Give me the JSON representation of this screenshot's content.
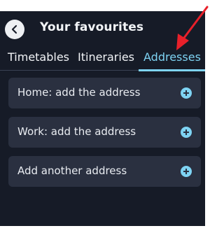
{
  "header": {
    "title": "Your favourites",
    "back_icon": "chevron-left-icon"
  },
  "tabs": [
    {
      "label": "Timetables",
      "active": false
    },
    {
      "label": "Itineraries",
      "active": false
    },
    {
      "label": "Addresses",
      "active": true
    }
  ],
  "addresses": [
    {
      "label": "Home: add the address",
      "icon": "plus-circle-icon"
    },
    {
      "label": "Work: add the address",
      "icon": "plus-circle-icon"
    },
    {
      "label": "Add another address",
      "icon": "plus-circle-icon"
    }
  ],
  "colors": {
    "background": "#161b27",
    "card": "#2a3040",
    "accent": "#7ed3f3",
    "annotation_arrow": "#e8202a"
  }
}
